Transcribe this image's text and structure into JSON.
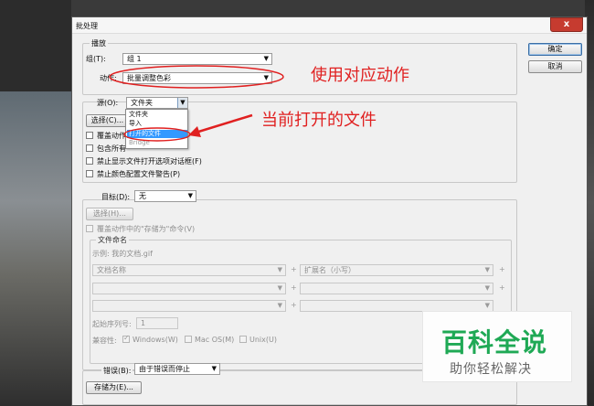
{
  "window": {
    "title": "批处理",
    "close_label": "x"
  },
  "buttons": {
    "ok": "确定",
    "cancel": "取消"
  },
  "play": {
    "group_label": "播放",
    "set_label": "组(T):",
    "set_value": "组 1",
    "action_label": "动作:",
    "action_value": "批量调整色彩"
  },
  "source": {
    "label": "源(O):",
    "value": "文件夹",
    "choose_button": "选择(C)...",
    "options": [
      "文件夹",
      "导入",
      "打开的文件",
      "Bridge"
    ],
    "selected_option": "打开的文件",
    "checkboxes": [
      {
        "label": "覆盖动作",
        "checked": false
      },
      {
        "label": "包含所有",
        "checked": false
      },
      {
        "label": "禁止显示文件打开选项对话框(F)",
        "checked": false
      },
      {
        "label": "禁止颜色配置文件警告(P)",
        "checked": false
      }
    ]
  },
  "destination": {
    "label": "目标(D):",
    "value": "无",
    "choose_button": "选择(H)...",
    "override_save_as": "覆盖动作中的\"存储为\"命令(V)",
    "file_naming": {
      "group_label": "文件命名",
      "example": "示例: 我的文档.gif",
      "rows": [
        {
          "left": "文档名称",
          "right": "扩展名（小写）"
        },
        {
          "left": "",
          "right": ""
        },
        {
          "left": "",
          "right": ""
        }
      ],
      "serial_label": "起始序列号:",
      "serial_value": "1",
      "compat_label": "兼容性:",
      "compat": [
        {
          "label": "Windows(W)",
          "checked": true
        },
        {
          "label": "Mac OS(M)",
          "checked": false
        },
        {
          "label": "Unix(U)",
          "checked": false
        }
      ]
    }
  },
  "errors": {
    "label": "错误(B):",
    "value": "由于错误而停止",
    "save_as_button": "存储为(E)..."
  },
  "annotations": {
    "action_note": "使用对应动作",
    "open_files_note": "当前打开的文件",
    "color": "#e02020"
  },
  "watermark": {
    "title": "百科全说",
    "subtitle": "助你轻松解决",
    "color": "#1fa955"
  }
}
